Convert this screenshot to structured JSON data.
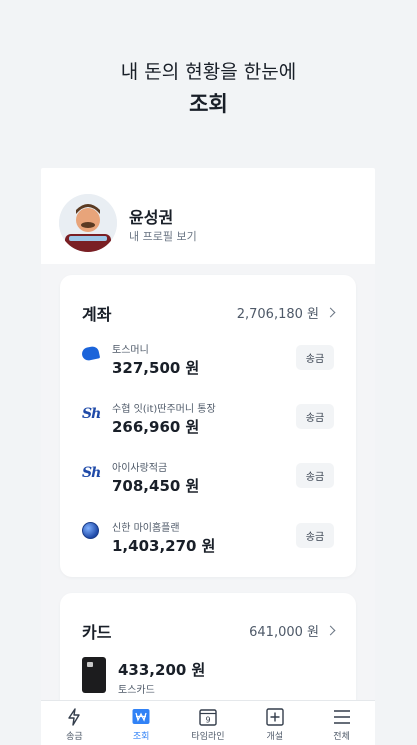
{
  "headline": {
    "line1": "내 돈의 현황을 한눈에",
    "line2": "조회"
  },
  "profile": {
    "name": "윤성권",
    "link": "내 프로필 보기"
  },
  "accounts": {
    "title": "계좌",
    "total": "2,706,180 원",
    "send_label": "송금",
    "items": [
      {
        "name": "토스머니",
        "amount": "327,500 원",
        "icon": "toss-icon"
      },
      {
        "name": "수협 잇(it)딴주머니 통장",
        "amount": "266,960 원",
        "icon": "suhyup-icon"
      },
      {
        "name": "아이사랑적금",
        "amount": "708,450 원",
        "icon": "suhyup-icon"
      },
      {
        "name": "신한 마이홈플랜",
        "amount": "1,403,270 원",
        "icon": "shinhan-icon"
      }
    ]
  },
  "cards": {
    "title": "카드",
    "total": "641,000 원",
    "item": {
      "amount": "433,200 원",
      "name": "토스카드"
    }
  },
  "tabbar": {
    "tabs": [
      {
        "label": "송금",
        "icon": "bolt-icon"
      },
      {
        "label": "조회",
        "icon": "won-icon"
      },
      {
        "label": "타임라인",
        "icon": "calendar-icon"
      },
      {
        "label": "개설",
        "icon": "plus-box-icon"
      },
      {
        "label": "전체",
        "icon": "menu-icon"
      }
    ],
    "active": "조회"
  },
  "colors": {
    "accent": "#3182f6",
    "toss_blue": "#1b64da",
    "background": "#f2f4f6"
  }
}
